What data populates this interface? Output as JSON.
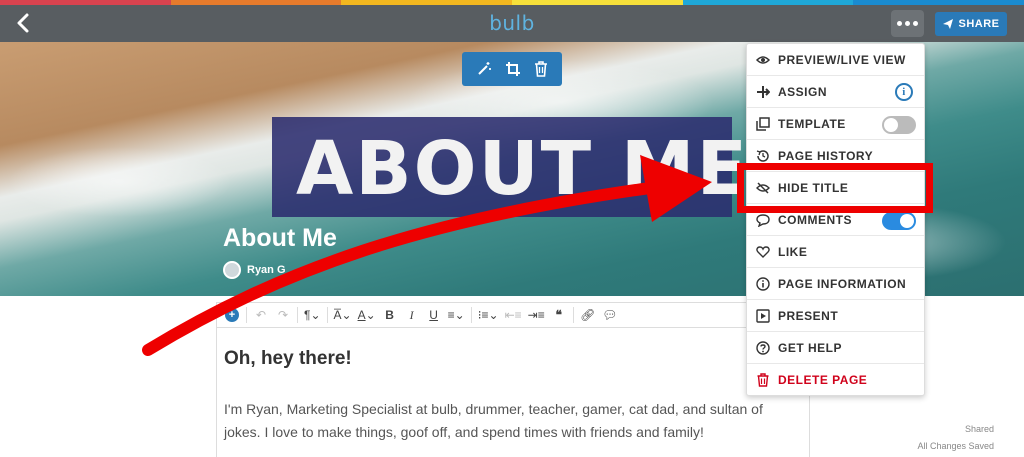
{
  "stripe_colors": [
    "#d9434f",
    "#e77b2c",
    "#f3b71f",
    "#f7e03a",
    "#1fa8d8",
    "#1a8bd0"
  ],
  "topbar": {
    "logo": "bulb",
    "share_label": "SHARE"
  },
  "hero": {
    "banner_text": "ABOUT ME",
    "title": "About Me",
    "author": "Ryan G"
  },
  "editor": {
    "toolbar": [
      "add",
      "undo",
      "redo",
      "paragraph",
      "text-size",
      "font-color",
      "bold",
      "italic",
      "underline",
      "align",
      "bullet-list",
      "indent",
      "outdent",
      "quote",
      "link",
      "comment"
    ],
    "heading": "Oh, hey there!",
    "paragraph": "I'm Ryan, Marketing Specialist at bulb, drummer, teacher, gamer, cat dad, and sultan of jokes. I love to make things, goof off, and spend times with friends and family!"
  },
  "status": {
    "line1": "Shared",
    "line2": "All Changes Saved"
  },
  "menu": {
    "items": [
      {
        "label": "PREVIEW/LIVE VIEW",
        "icon": "eye-icon"
      },
      {
        "label": "ASSIGN",
        "icon": "assign-icon"
      },
      {
        "label": "TEMPLATE",
        "icon": "template-icon",
        "toggle": false
      },
      {
        "label": "PAGE HISTORY",
        "icon": "history-icon"
      },
      {
        "label": "HIDE TITLE",
        "icon": "eye-slash-icon"
      },
      {
        "label": "COMMENTS",
        "icon": "comment-icon",
        "toggle": true
      },
      {
        "label": "LIKE",
        "icon": "heart-icon"
      },
      {
        "label": "PAGE INFORMATION",
        "icon": "info-icon"
      },
      {
        "label": "PRESENT",
        "icon": "present-icon"
      },
      {
        "label": "GET HELP",
        "icon": "help-icon"
      },
      {
        "label": "DELETE PAGE",
        "icon": "trash-icon"
      }
    ]
  },
  "colors": {
    "accent": "#2a7ab8",
    "annotation": "#ee0000",
    "danger": "#d0021b"
  }
}
